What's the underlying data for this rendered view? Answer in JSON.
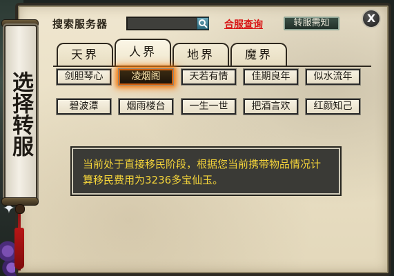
{
  "window": {
    "title": "选择转服",
    "close_label": "X"
  },
  "search": {
    "label": "搜索服务器",
    "value": "",
    "button_icon": "search-icon"
  },
  "toolbar": {
    "merge_query_label": "合服查询",
    "transfer_notice_label": "转服需知"
  },
  "tabs": [
    {
      "label": "天界",
      "active": false
    },
    {
      "label": "人界",
      "active": true
    },
    {
      "label": "地界",
      "active": false
    },
    {
      "label": "魔界",
      "active": false
    }
  ],
  "servers": [
    {
      "label": "剑胆琴心",
      "selected": false
    },
    {
      "label": "凌烟阁",
      "selected": true
    },
    {
      "label": "天若有情",
      "selected": false
    },
    {
      "label": "佳期良年",
      "selected": false
    },
    {
      "label": "似水流年",
      "selected": false
    },
    {
      "label": "碧波潭",
      "selected": false
    },
    {
      "label": "烟雨楼台",
      "selected": false
    },
    {
      "label": "一生一世",
      "selected": false
    },
    {
      "label": "把酒言欢",
      "selected": false
    },
    {
      "label": "红颜知己",
      "selected": false
    }
  ],
  "info": {
    "text": "当前处于直接移民阶段，根据您当前携带物品情况计算移民费用为3236多宝仙玉。"
  },
  "colors": {
    "merge_link": "#d81414",
    "info_text": "#f4d43a",
    "selected_glow": "#f07a10"
  }
}
